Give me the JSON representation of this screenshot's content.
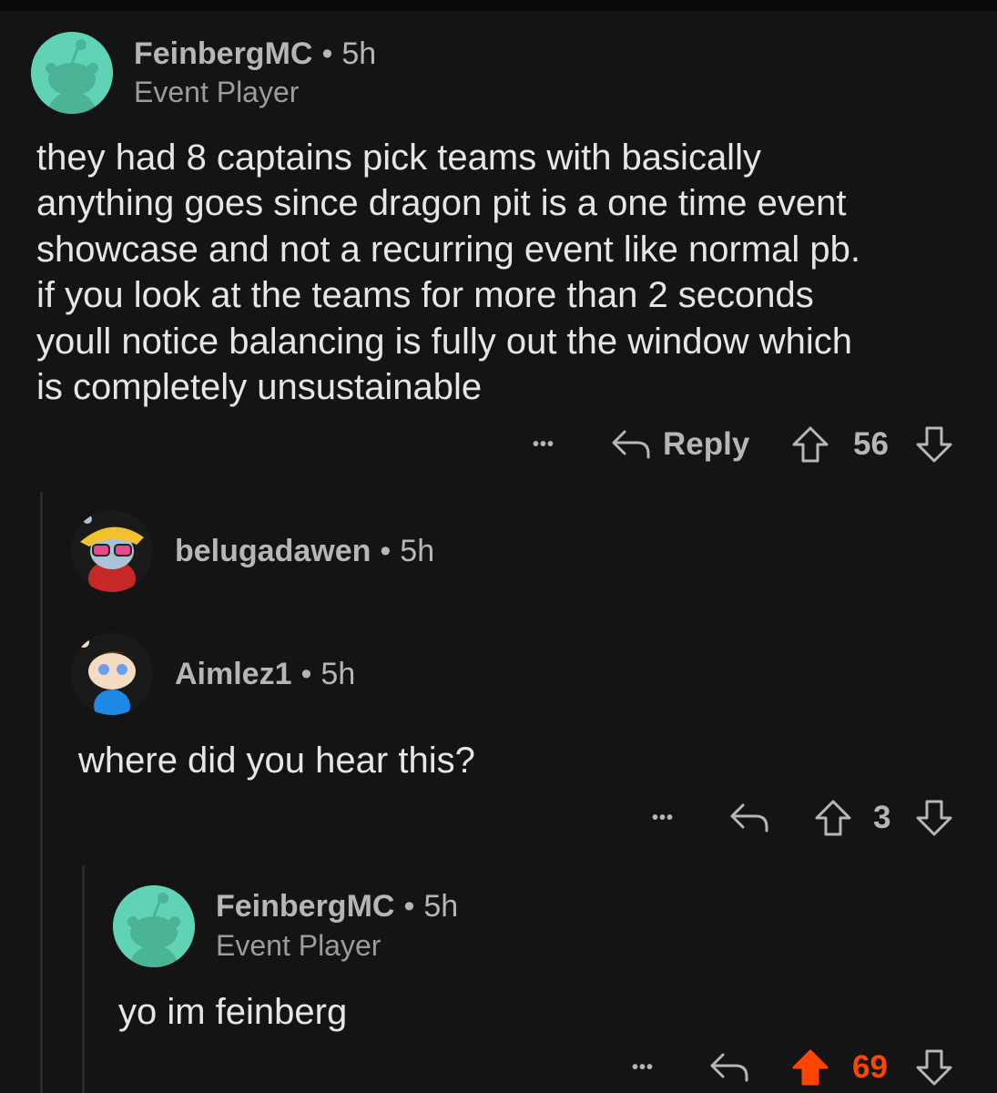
{
  "comments": [
    {
      "username": "FeinbergMC",
      "separator": "•",
      "time": "5h",
      "flair": "Event Player",
      "body": [
        "they had 8 captains pick teams with basically",
        "anything goes since dragon pit is a one time event",
        "showcase and not a recurring event like normal pb.",
        "if you look at the teams for more than 2 seconds",
        "youll notice balancing is fully out the window which",
        "is completely unsustainable"
      ],
      "more_label": "•••",
      "reply_label": "Reply",
      "score": "56",
      "avatar_color": "#5fd3b3"
    },
    {
      "username": "belugadawen",
      "separator": "•",
      "time": "5h"
    },
    {
      "username": "Aimlez1",
      "separator": "•",
      "time": "5h",
      "body": "where did you hear this?",
      "more_label": "•••",
      "score": "3"
    },
    {
      "username": "FeinbergMC",
      "separator": "•",
      "time": "5h",
      "flair": "Event Player",
      "body": "yo im feinberg",
      "more_label": "•••",
      "score": "69",
      "upvoted": true,
      "upvote_color": "#ff4500",
      "avatar_color": "#5fd3b3"
    }
  ]
}
